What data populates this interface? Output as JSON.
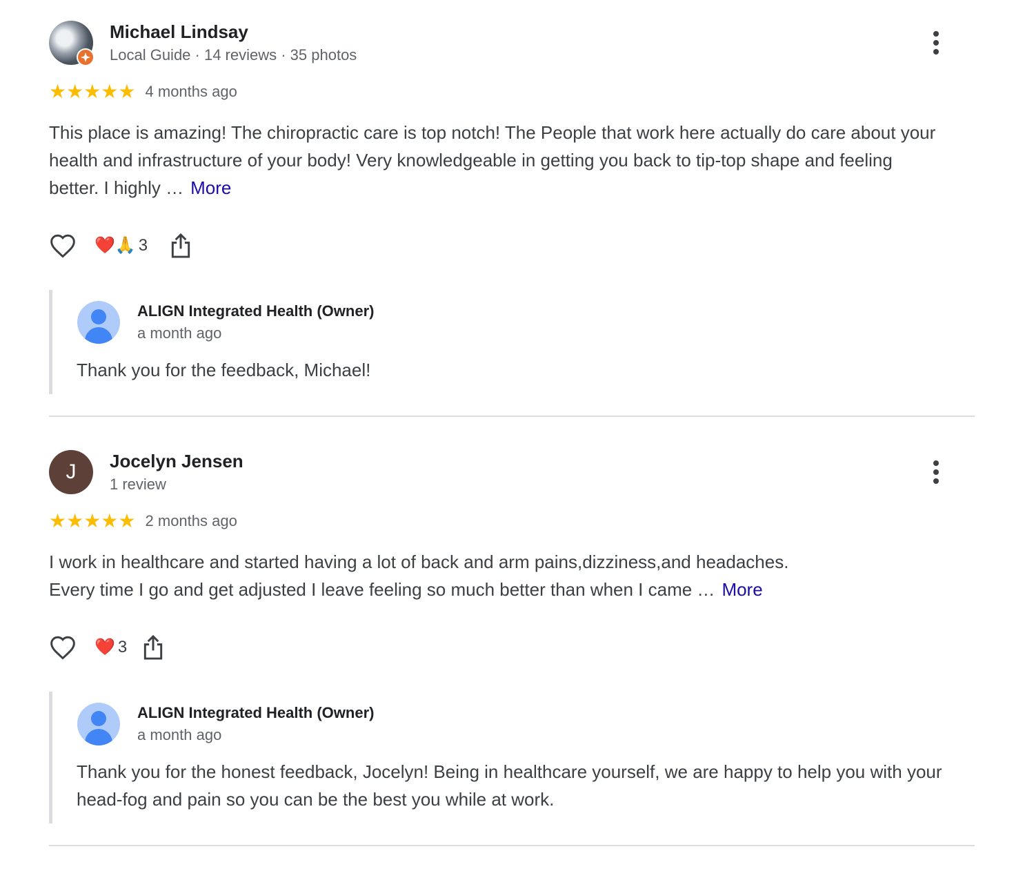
{
  "reviews": [
    {
      "name": "Michael Lindsay",
      "meta": "Local Guide · 14 reviews · 35 photos",
      "avatar_type": "photo",
      "local_guide_badge": true,
      "rating": 5,
      "stars": "★★★★★",
      "date": "4 months ago",
      "text": "This place is amazing! The chiropractic care is top notch! The People that work here actually do care about your health and infrastructure of your body! Very knowledgeable in getting you back to tip-top shape and feeling better. I highly …",
      "more_label": "More",
      "reaction_emojis": "❤️🙏",
      "reaction_count": "3",
      "reply": {
        "name": "ALIGN Integrated Health (Owner)",
        "date": "a month ago",
        "text": "Thank you for the feedback, Michael!"
      }
    },
    {
      "name": "Jocelyn Jensen",
      "meta": "1 review",
      "avatar_type": "letter",
      "avatar_letter": "J",
      "avatar_color": "#5d4037",
      "rating": 5,
      "stars": "★★★★★",
      "date": "2 months ago",
      "text_line1": "I work in healthcare and started having a lot of back and arm pains,dizziness,and headaches.",
      "text_line2": "Every time I go and get adjusted I leave feeling so much better than when I came …",
      "more_label": "More",
      "reaction_emojis": "❤️",
      "reaction_count": "3",
      "reply": {
        "name": "ALIGN Integrated Health (Owner)",
        "date": "a month ago",
        "text": "Thank you for the honest feedback, Jocelyn! Being in healthcare yourself, we are happy to help you with your head-fog and pain so you can be the best you while at work."
      }
    }
  ],
  "colors": {
    "star": "#fbbc04",
    "link": "#1a0dab",
    "local_guide_badge": "#e8712e",
    "owner_avatar_bg": "#aecbfa",
    "owner_avatar_fg": "#4285f4"
  }
}
